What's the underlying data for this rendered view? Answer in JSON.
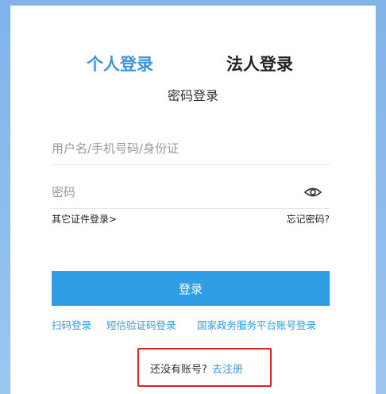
{
  "tabs": {
    "personal": "个人登录",
    "legal": "法人登录"
  },
  "subtitle": "密码登录",
  "fields": {
    "username_placeholder": "用户名/手机号码/身份证",
    "password_placeholder": "密码"
  },
  "icons": {
    "password_toggle": "eye-icon"
  },
  "links": {
    "other_id": "其它证件登录>",
    "forgot": "忘记密码?"
  },
  "login_button": "登录",
  "alt_logins": [
    "扫码登录",
    "短信验证码登录",
    "国家政务服务平台账号登录"
  ],
  "register": {
    "prompt": "还没有账号?",
    "link": "去注册"
  },
  "colors": {
    "accent": "#2f9ee6",
    "highlight_box": "#e02020",
    "background": "#8ebdf0"
  }
}
